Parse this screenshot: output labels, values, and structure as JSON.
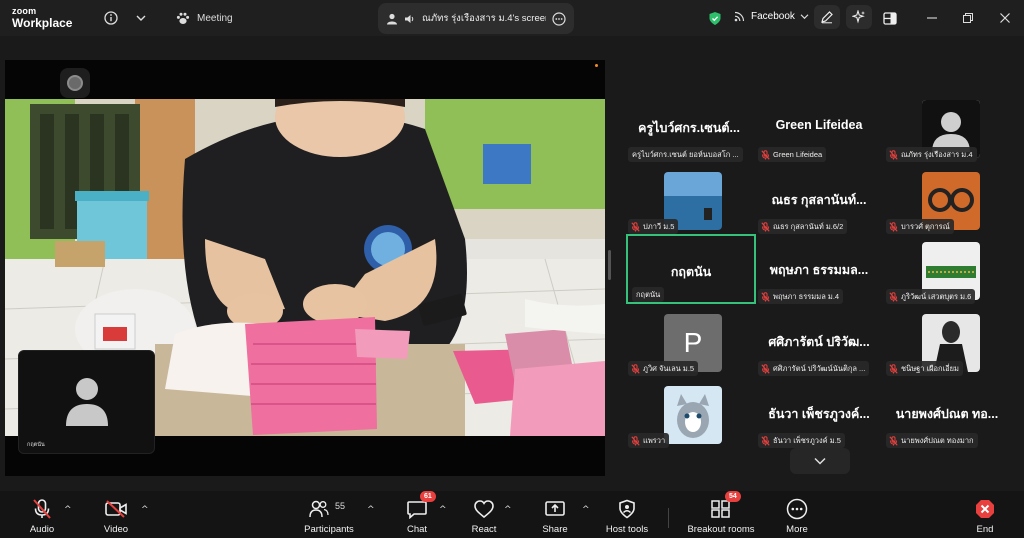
{
  "app": {
    "logo_line1": "zoom",
    "logo_line2": "Workplace"
  },
  "topbar": {
    "meeting_label": "Meeting",
    "screen_share_label": "ณภัทร รุ่งเรืองสาร ม.4's screen",
    "facebook_label": "Facebook"
  },
  "share": {
    "self_view_name": "กฤตนัน"
  },
  "gallery": {
    "tiles": [
      {
        "big": "ครูไบว์ศกร.เซนต์...",
        "label": "ครูไบว์ศกร.เซนต์ ยอห์นบอสโก ...",
        "muted": false
      },
      {
        "big": "Green Lifeidea",
        "label": "Green Lifeidea",
        "muted": true
      },
      {
        "big": "",
        "label": "ณภัทร รุ่งเรืองสาร ม.4",
        "muted": true
      },
      {
        "big": "",
        "label": "ปภาวี ม.5",
        "muted": true
      },
      {
        "big": "ณธร กุสลานันท์...",
        "label": "ณธร กุสลานันท์ ม.6/2",
        "muted": true
      },
      {
        "big": "",
        "label": "บารวศ์ ตุการณ์",
        "muted": true
      },
      {
        "big": "กฤตนัน",
        "label": "กฤตนัน",
        "muted": false
      },
      {
        "big": "พฤษภา ธรรมมล...",
        "label": "พฤษภา ธรรมมล ม.4",
        "muted": true
      },
      {
        "big": "",
        "label": "ภูริวัฒน์ เสวตบุตร ม.6",
        "muted": true
      },
      {
        "big": "",
        "label": "ภูวิศ จันเลน ม.5",
        "muted": true,
        "avatar_letter": "P"
      },
      {
        "big": "ศศิภารัตน์ ปริวัฒ...",
        "label": "ศศิภารัตน์ ปริวัฒน์นันติกุล ...",
        "muted": true
      },
      {
        "big": "",
        "label": "ชนิษฐา เผือกเอี่ยม",
        "muted": true
      },
      {
        "big": "",
        "label": "แพรวา",
        "muted": true
      },
      {
        "big": "ธันวา เพ็ชรภูวงค์...",
        "label": "ธันวา เพ็ชรภูวงค์ ม.5",
        "muted": true
      },
      {
        "big": "นายพงศ์ปณต ทอ...",
        "label": "นายพงศ์ปณต ทองมาก",
        "muted": true
      }
    ]
  },
  "toolbar": {
    "audio": "Audio",
    "video": "Video",
    "participants": "Participants",
    "participants_count": "55",
    "chat": "Chat",
    "chat_badge": "61",
    "react": "React",
    "share": "Share",
    "host_tools": "Host tools",
    "breakout_rooms": "Breakout rooms",
    "breakout_badge": "54",
    "more": "More",
    "end": "End"
  },
  "colors": {
    "active_speaker": "#36c27a",
    "muted_red": "#e8403e",
    "shield_green": "#2dbf6b",
    "end_red": "#e8403e"
  }
}
